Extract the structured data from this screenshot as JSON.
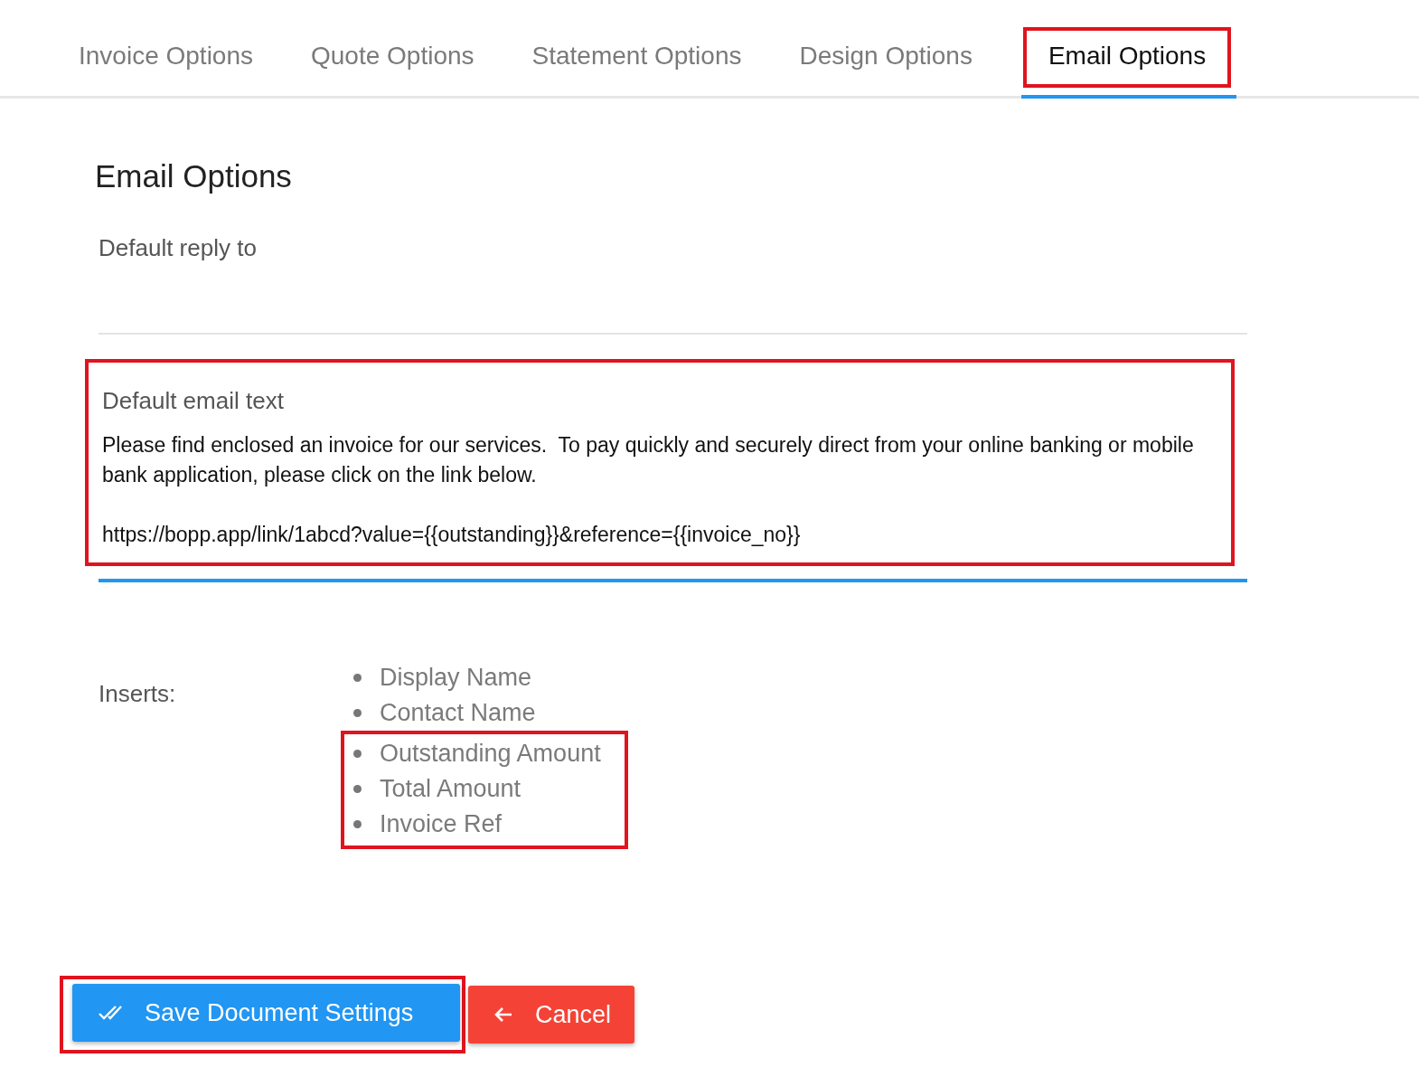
{
  "tabs": [
    {
      "label": "Invoice Options",
      "selected": false,
      "highlighted": false
    },
    {
      "label": "Quote Options",
      "selected": false,
      "highlighted": false
    },
    {
      "label": "Statement Options",
      "selected": false,
      "highlighted": false
    },
    {
      "label": "Design Options",
      "selected": false,
      "highlighted": false
    },
    {
      "label": "Email Options",
      "selected": true,
      "highlighted": true
    }
  ],
  "heading": "Email Options",
  "reply_field": {
    "label": "Default reply to"
  },
  "email_field": {
    "label": "Default email text",
    "value": "Please find enclosed an invoice for our services.  To pay quickly and securely direct from your online banking or mobile bank application, please click on the link below.\n\nhttps://bopp.app/link/1abcd?value={{outstanding}}&reference={{invoice_no}}",
    "highlighted": true,
    "focused": true
  },
  "inserts": {
    "label": "Inserts:",
    "items": [
      {
        "label": "Display Name",
        "highlighted": false
      },
      {
        "label": "Contact Name",
        "highlighted": false
      },
      {
        "label": "Outstanding Amount",
        "highlighted": true
      },
      {
        "label": "Total Amount",
        "highlighted": true
      },
      {
        "label": "Invoice Ref",
        "highlighted": true
      }
    ]
  },
  "buttons": [
    {
      "kind": "save",
      "label": "Save Document Settings",
      "highlighted": true
    },
    {
      "kind": "cancel",
      "label": "Cancel",
      "highlighted": false
    }
  ]
}
